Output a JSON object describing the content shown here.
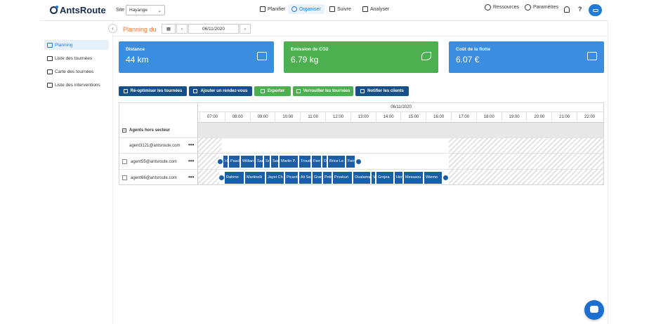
{
  "app": {
    "logo": "AntsRoute"
  },
  "header": {
    "site_label": "Site",
    "site_value": "Hayange",
    "nav": [
      {
        "label": "Planifier",
        "icon": "calendar-icon"
      },
      {
        "label": "Organiser",
        "icon": "route-icon",
        "active": true
      },
      {
        "label": "Suivre",
        "icon": "flag-icon"
      },
      {
        "label": "Analyser",
        "icon": "chart-icon"
      }
    ],
    "resources_label": "Ressources",
    "settings_label": "Paramètres",
    "help_label": "?"
  },
  "sidebar": {
    "items": [
      {
        "label": "Planning",
        "icon": "calendar-check-icon",
        "active": true
      },
      {
        "label": "Liste des tournées",
        "icon": "book-icon"
      },
      {
        "label": "Carte des tournées",
        "icon": "map-icon"
      },
      {
        "label": "Liste des interventions",
        "icon": "list-icon"
      }
    ]
  },
  "planning": {
    "title": "Planning du",
    "date": "06/11/2020",
    "prev": "‹",
    "next": "›"
  },
  "cards": [
    {
      "label": "Distance",
      "value": "44 km",
      "color": "#3b8de0",
      "icon": "map-book-icon"
    },
    {
      "label": "Emission de CO2",
      "value": "6.79 kg",
      "color": "#4caf50",
      "icon": "leaf-icon"
    },
    {
      "label": "Coût de la flotte",
      "value": "6.07 €",
      "color": "#3b8de0",
      "icon": "money-icon"
    }
  ],
  "actions": [
    {
      "label": "Ré-optimiser les tournées",
      "color": "navy",
      "icon": "magic-icon"
    },
    {
      "label": "Ajouter un rendez-vous",
      "color": "navy",
      "icon": "calendar-add-icon"
    },
    {
      "label": "Exporter",
      "color": "green",
      "icon": "cloud-icon"
    },
    {
      "label": "Verrouiller les tournées",
      "color": "green",
      "icon": "lock-icon"
    },
    {
      "label": "Notifier les clients",
      "color": "navy",
      "icon": "bell-icon"
    }
  ],
  "gantt": {
    "date": "06/11/2020",
    "hours": [
      "07:00",
      "08:00",
      "09:00",
      "10:00",
      "11:00",
      "12:00",
      "13:00",
      "14:00",
      "15:00",
      "16:00",
      "17:00",
      "18:00",
      "19:00",
      "20:00",
      "21:00",
      "22:00"
    ],
    "group_label": "Agents hors secteur",
    "agents": [
      {
        "email": "agent3121@antsroute.com",
        "more": "•••"
      },
      {
        "email": "agent55@antsroute.com",
        "more": "•••"
      },
      {
        "email": "agent66@antsroute.com",
        "more": "•••"
      }
    ],
    "row2_tasks": [
      "H",
      "Pascl",
      "Willian",
      "San",
      "Sr",
      "Sar",
      "Martin P.",
      "Troudi",
      "Ferr",
      "D",
      "Brice Le",
      "Ferr"
    ],
    "row3_tasks": [
      "Rahmo",
      "Martinelli",
      "Jayet Ch",
      "Picard",
      "Ali Sa",
      "Gran",
      "Petit",
      "Proskuri",
      "Oualama",
      "V",
      "Grojea",
      "Her",
      "Messaou",
      "Wiemo"
    ]
  },
  "colors": {
    "accent": "#1f7bd6",
    "orange": "#e8732a",
    "task": "#1a5ea6"
  }
}
